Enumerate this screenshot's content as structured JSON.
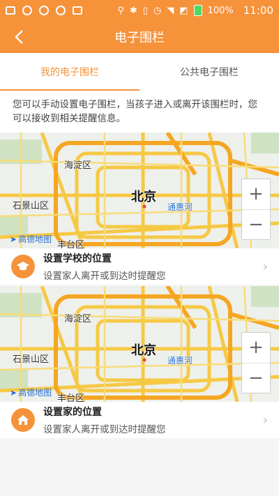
{
  "status": {
    "battery": "100%",
    "time": "11:00"
  },
  "nav": {
    "title": "电子围栏"
  },
  "tabs": [
    {
      "label": "我的电子围栏"
    },
    {
      "label": "公共电子围栏"
    }
  ],
  "description": "您可以手动设置电子围栏，当孩子进入或离开该围栏时，您可以接收到相关提醒信息。",
  "map": {
    "labels": {
      "haidian": "海淀区",
      "beijing": "北京",
      "shijingshan": "石景山区",
      "tonghuihe": "通惠河",
      "fengtai": "丰台区",
      "amap": "高德地图"
    },
    "zoom_in": "+",
    "zoom_out": "−"
  },
  "items": [
    {
      "title": "设置学校的位置",
      "subtitle": "设置家人离开或到达时提醒您",
      "icon": "school-icon"
    },
    {
      "title": "设置家的位置",
      "subtitle": "设置家人离开或到达时提醒您",
      "icon": "home-icon"
    }
  ],
  "colors": {
    "accent": "#f5923a",
    "road": "#f6c945",
    "ring": "#f5a623"
  }
}
